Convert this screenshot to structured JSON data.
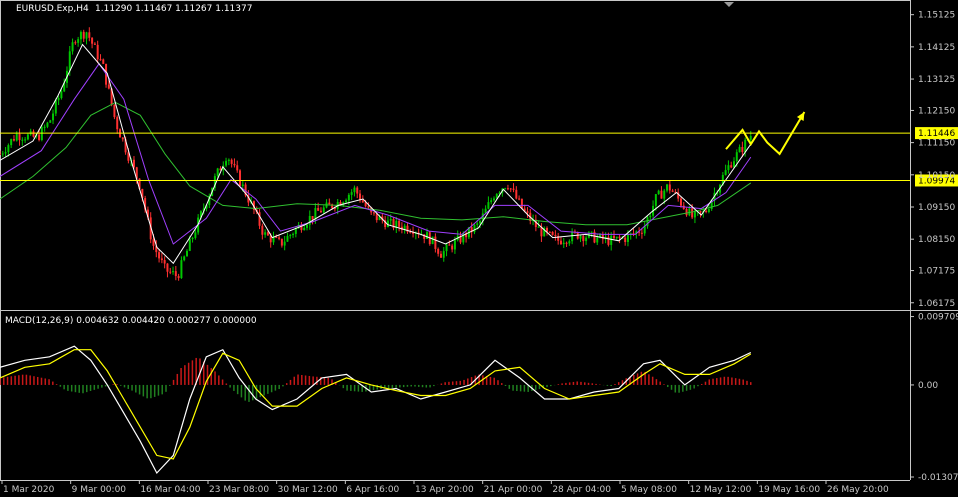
{
  "header": {
    "symbol_label": "EURUSD.Exp,H4",
    "ohlc_label": "1.11290 1.11467 1.11267 1.11377"
  },
  "colors": {
    "background": "#000000",
    "axis": "#c8c8c8",
    "bull_candle": "#00c800",
    "bear_candle": "#ff3030",
    "ma_fast": "#ffffff",
    "ma_mid": "#a040ff",
    "ma_slow": "#30c030",
    "level_line": "#ffff00",
    "arrow": "#ffff00",
    "macd_hist_pos": "#c81818",
    "macd_hist_neg": "#208020",
    "macd_line": "#ffffff",
    "signal_line": "#ffff00"
  },
  "chart_data": {
    "type": "candlestick",
    "symbol": "EURUSD.Exp",
    "timeframe": "H4",
    "price_axis": {
      "range": [
        1.0595,
        1.1555
      ],
      "ticks": [
        "1.15125",
        "1.14125",
        "1.13125",
        "1.12150",
        "1.11150",
        "1.10150",
        "1.09150",
        "1.08150",
        "1.07175",
        "1.06175"
      ]
    },
    "levels": [
      {
        "price": 1.11446,
        "label": "1.11446"
      },
      {
        "price": 1.09974,
        "label": "1.09974"
      }
    ],
    "x_ticks": [
      "1 Mar 2020",
      "9 Mar 00:00",
      "16 Mar 04:00",
      "23 Mar 08:00",
      "30 Mar 12:00",
      "6 Apr 16:00",
      "13 Apr 20:00",
      "21 Apr 00:00",
      "28 Apr 04:00",
      "5 May 08:00",
      "12 May 12:00",
      "19 May 16:00",
      "26 May 20:00"
    ],
    "close_path": [
      [
        0,
        1.108
      ],
      [
        0.02,
        1.114
      ],
      [
        0.045,
        1.113
      ],
      [
        0.06,
        1.118
      ],
      [
        0.075,
        1.128
      ],
      [
        0.09,
        1.144
      ],
      [
        0.105,
        1.146
      ],
      [
        0.125,
        1.135
      ],
      [
        0.14,
        1.118
      ],
      [
        0.155,
        1.108
      ],
      [
        0.17,
        1.098
      ],
      [
        0.185,
        1.08
      ],
      [
        0.2,
        1.072
      ],
      [
        0.215,
        1.07
      ],
      [
        0.23,
        1.08
      ],
      [
        0.245,
        1.09
      ],
      [
        0.26,
        1.1
      ],
      [
        0.275,
        1.108
      ],
      [
        0.29,
        1.1
      ],
      [
        0.305,
        1.092
      ],
      [
        0.32,
        1.083
      ],
      [
        0.34,
        1.08
      ],
      [
        0.36,
        1.085
      ],
      [
        0.385,
        1.09
      ],
      [
        0.41,
        1.093
      ],
      [
        0.43,
        1.097
      ],
      [
        0.45,
        1.089
      ],
      [
        0.475,
        1.086
      ],
      [
        0.5,
        1.085
      ],
      [
        0.52,
        1.082
      ],
      [
        0.535,
        1.077
      ],
      [
        0.555,
        1.081
      ],
      [
        0.58,
        1.086
      ],
      [
        0.6,
        1.096
      ],
      [
        0.615,
        1.099
      ],
      [
        0.635,
        1.09
      ],
      [
        0.655,
        1.084
      ],
      [
        0.675,
        1.081
      ],
      [
        0.7,
        1.083
      ],
      [
        0.72,
        1.082
      ],
      [
        0.74,
        1.081
      ],
      [
        0.76,
        1.082
      ],
      [
        0.78,
        1.085
      ],
      [
        0.795,
        1.094
      ],
      [
        0.81,
        1.098
      ],
      [
        0.825,
        1.093
      ],
      [
        0.84,
        1.088
      ],
      [
        0.855,
        1.09
      ],
      [
        0.87,
        1.098
      ],
      [
        0.885,
        1.105
      ],
      [
        0.9,
        1.11
      ],
      [
        0.91,
        1.1138
      ]
    ],
    "ma_fast": [
      [
        0,
        1.106
      ],
      [
        0.04,
        1.112
      ],
      [
        0.07,
        1.126
      ],
      [
        0.1,
        1.142
      ],
      [
        0.13,
        1.133
      ],
      [
        0.16,
        1.105
      ],
      [
        0.19,
        1.079
      ],
      [
        0.21,
        1.074
      ],
      [
        0.24,
        1.086
      ],
      [
        0.27,
        1.104
      ],
      [
        0.3,
        1.095
      ],
      [
        0.33,
        1.082
      ],
      [
        0.37,
        1.086
      ],
      [
        0.41,
        1.092
      ],
      [
        0.44,
        1.094
      ],
      [
        0.47,
        1.086
      ],
      [
        0.51,
        1.083
      ],
      [
        0.54,
        1.08
      ],
      [
        0.58,
        1.085
      ],
      [
        0.61,
        1.097
      ],
      [
        0.64,
        1.089
      ],
      [
        0.67,
        1.082
      ],
      [
        0.71,
        1.083
      ],
      [
        0.75,
        1.081
      ],
      [
        0.79,
        1.09
      ],
      [
        0.82,
        1.096
      ],
      [
        0.85,
        1.089
      ],
      [
        0.88,
        1.1
      ],
      [
        0.91,
        1.111
      ]
    ],
    "ma_mid": [
      [
        0,
        1.101
      ],
      [
        0.05,
        1.109
      ],
      [
        0.09,
        1.125
      ],
      [
        0.12,
        1.136
      ],
      [
        0.15,
        1.125
      ],
      [
        0.18,
        1.1
      ],
      [
        0.21,
        1.08
      ],
      [
        0.25,
        1.088
      ],
      [
        0.28,
        1.1
      ],
      [
        0.31,
        1.094
      ],
      [
        0.34,
        1.084
      ],
      [
        0.38,
        1.087
      ],
      [
        0.43,
        1.092
      ],
      [
        0.47,
        1.089
      ],
      [
        0.52,
        1.084
      ],
      [
        0.56,
        1.083
      ],
      [
        0.6,
        1.092
      ],
      [
        0.64,
        1.092
      ],
      [
        0.68,
        1.084
      ],
      [
        0.73,
        1.083
      ],
      [
        0.77,
        1.083
      ],
      [
        0.81,
        1.092
      ],
      [
        0.85,
        1.091
      ],
      [
        0.88,
        1.096
      ],
      [
        0.91,
        1.107
      ]
    ],
    "ma_slow": [
      [
        0,
        1.094
      ],
      [
        0.04,
        1.101
      ],
      [
        0.08,
        1.11
      ],
      [
        0.11,
        1.12
      ],
      [
        0.14,
        1.124
      ],
      [
        0.17,
        1.12
      ],
      [
        0.2,
        1.108
      ],
      [
        0.23,
        1.098
      ],
      [
        0.27,
        1.092
      ],
      [
        0.31,
        1.091
      ],
      [
        0.36,
        1.0925
      ],
      [
        0.41,
        1.092
      ],
      [
        0.46,
        1.0905
      ],
      [
        0.51,
        1.088
      ],
      [
        0.56,
        1.0875
      ],
      [
        0.61,
        1.0885
      ],
      [
        0.66,
        1.087
      ],
      [
        0.71,
        1.086
      ],
      [
        0.76,
        1.086
      ],
      [
        0.8,
        1.088
      ],
      [
        0.84,
        1.09
      ],
      [
        0.87,
        1.092
      ],
      [
        0.91,
        1.099
      ]
    ],
    "forecast_arrow": [
      [
        0.88,
        1.1095
      ],
      [
        0.9,
        1.1155
      ],
      [
        0.91,
        1.111
      ],
      [
        0.92,
        1.115
      ],
      [
        0.93,
        1.1115
      ],
      [
        0.945,
        1.108
      ],
      [
        0.975,
        1.121
      ]
    ],
    "macd": {
      "label": "MACD(12,26,9) 0.004632 0.004420 0.000277 0.000000",
      "range": [
        -0.0135,
        0.0105
      ],
      "ticks": [
        "0.009709",
        "0.00",
        "-0.013074"
      ],
      "tick_values": [
        0.009709,
        0,
        -0.013074
      ],
      "histogram": [
        [
          0,
          0.001
        ],
        [
          0.03,
          0.0015
        ],
        [
          0.06,
          0.0008
        ],
        [
          0.08,
          -0.0008
        ],
        [
          0.1,
          -0.0012
        ],
        [
          0.12,
          -0.0005
        ],
        [
          0.14,
          0.0002
        ],
        [
          0.16,
          -0.0008
        ],
        [
          0.18,
          -0.002
        ],
        [
          0.2,
          -0.0012
        ],
        [
          0.22,
          0.0025
        ],
        [
          0.24,
          0.004
        ],
        [
          0.26,
          0.002
        ],
        [
          0.28,
          -0.0005
        ],
        [
          0.3,
          -0.0025
        ],
        [
          0.32,
          -0.0015
        ],
        [
          0.34,
          -0.0005
        ],
        [
          0.36,
          0.0015
        ],
        [
          0.38,
          0.0012
        ],
        [
          0.4,
          0.001
        ],
        [
          0.42,
          -0.0008
        ],
        [
          0.44,
          -0.001
        ],
        [
          0.46,
          -0.0006
        ],
        [
          0.48,
          -0.0004
        ],
        [
          0.5,
          -0.0002
        ],
        [
          0.52,
          -0.0004
        ],
        [
          0.54,
          0.0004
        ],
        [
          0.56,
          0.0006
        ],
        [
          0.58,
          0.0015
        ],
        [
          0.6,
          0.001
        ],
        [
          0.62,
          -0.0008
        ],
        [
          0.64,
          -0.001
        ],
        [
          0.66,
          -0.0004
        ],
        [
          0.68,
          0.0002
        ],
        [
          0.7,
          0.0005
        ],
        [
          0.72,
          0.0002
        ],
        [
          0.74,
          -0.0002
        ],
        [
          0.76,
          0.001
        ],
        [
          0.78,
          0.002
        ],
        [
          0.8,
          0.0005
        ],
        [
          0.82,
          -0.0012
        ],
        [
          0.84,
          -0.0006
        ],
        [
          0.86,
          0.0008
        ],
        [
          0.88,
          0.0012
        ],
        [
          0.9,
          0.0008
        ],
        [
          0.91,
          0.0004
        ]
      ],
      "macd_line": [
        [
          0,
          0.0025
        ],
        [
          0.03,
          0.0035
        ],
        [
          0.06,
          0.004
        ],
        [
          0.09,
          0.0055
        ],
        [
          0.11,
          0.0035
        ],
        [
          0.13,
          0.0
        ],
        [
          0.15,
          -0.004
        ],
        [
          0.17,
          -0.008
        ],
        [
          0.19,
          -0.0125
        ],
        [
          0.21,
          -0.01
        ],
        [
          0.23,
          -0.002
        ],
        [
          0.25,
          0.004
        ],
        [
          0.27,
          0.005
        ],
        [
          0.29,
          0.001
        ],
        [
          0.31,
          -0.002
        ],
        [
          0.33,
          -0.0035
        ],
        [
          0.36,
          -0.002
        ],
        [
          0.39,
          0.001
        ],
        [
          0.42,
          0.0015
        ],
        [
          0.45,
          -0.001
        ],
        [
          0.48,
          -0.0005
        ],
        [
          0.51,
          -0.002
        ],
        [
          0.54,
          -0.001
        ],
        [
          0.57,
          0.0
        ],
        [
          0.6,
          0.0035
        ],
        [
          0.63,
          0.001
        ],
        [
          0.66,
          -0.002
        ],
        [
          0.69,
          -0.002
        ],
        [
          0.72,
          -0.001
        ],
        [
          0.75,
          -0.0005
        ],
        [
          0.78,
          0.003
        ],
        [
          0.8,
          0.0035
        ],
        [
          0.83,
          0.0
        ],
        [
          0.86,
          0.0025
        ],
        [
          0.89,
          0.0035
        ],
        [
          0.91,
          0.0046
        ]
      ],
      "signal_line": [
        [
          0,
          0.001
        ],
        [
          0.03,
          0.0025
        ],
        [
          0.06,
          0.003
        ],
        [
          0.09,
          0.005
        ],
        [
          0.11,
          0.005
        ],
        [
          0.13,
          0.002
        ],
        [
          0.15,
          -0.002
        ],
        [
          0.17,
          -0.006
        ],
        [
          0.19,
          -0.01
        ],
        [
          0.21,
          -0.0105
        ],
        [
          0.23,
          -0.006
        ],
        [
          0.25,
          0.0005
        ],
        [
          0.27,
          0.0045
        ],
        [
          0.29,
          0.0035
        ],
        [
          0.31,
          -0.0005
        ],
        [
          0.33,
          -0.003
        ],
        [
          0.36,
          -0.003
        ],
        [
          0.39,
          -0.0005
        ],
        [
          0.42,
          0.001
        ],
        [
          0.45,
          0.0
        ],
        [
          0.48,
          -0.0008
        ],
        [
          0.51,
          -0.0015
        ],
        [
          0.54,
          -0.0015
        ],
        [
          0.57,
          -0.0005
        ],
        [
          0.6,
          0.002
        ],
        [
          0.63,
          0.0025
        ],
        [
          0.66,
          -0.0005
        ],
        [
          0.69,
          -0.002
        ],
        [
          0.72,
          -0.0015
        ],
        [
          0.75,
          -0.001
        ],
        [
          0.78,
          0.0015
        ],
        [
          0.8,
          0.003
        ],
        [
          0.83,
          0.0015
        ],
        [
          0.86,
          0.0015
        ],
        [
          0.89,
          0.003
        ],
        [
          0.91,
          0.0044
        ]
      ]
    }
  }
}
